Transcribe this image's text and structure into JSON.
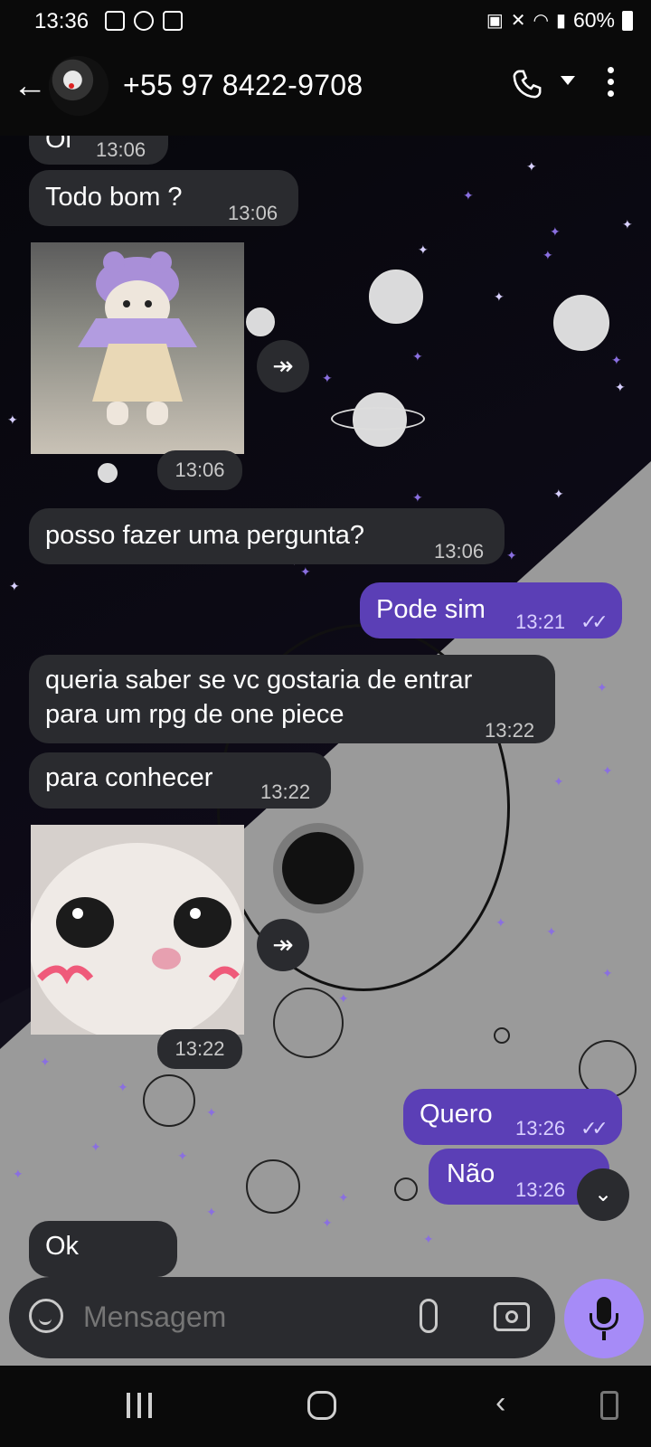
{
  "status_bar": {
    "time": "13:36",
    "battery": "60%"
  },
  "header": {
    "title": "+55 97 8422-9708"
  },
  "messages": [
    {
      "text": "Oi",
      "time": "13:06"
    },
    {
      "text": "Todo bom ?",
      "time": "13:06"
    },
    {
      "sticker": "cat-in-hat",
      "time": "13:06"
    },
    {
      "text": "posso fazer uma pergunta?",
      "time": "13:06"
    },
    {
      "text": "Pode sim",
      "time": "13:21",
      "ticks": "✓✓"
    },
    {
      "text_line1": "queria saber se vc gostaria de entrar",
      "text_line2": "para um rpg de one piece",
      "time": "13:22"
    },
    {
      "text": "para conhecer",
      "time": "13:22"
    },
    {
      "sticker": "cat-closeup",
      "time": "13:22"
    },
    {
      "text": "Quero",
      "time": "13:26",
      "ticks": "✓✓"
    },
    {
      "text": "Não",
      "time": "13:26"
    },
    {
      "text": "Ok"
    }
  ],
  "input": {
    "placeholder": "Mensagem"
  },
  "colors": {
    "incoming": "#2a2b2f",
    "outgoing": "#5b3fb6",
    "mic": "#a68bf7"
  }
}
